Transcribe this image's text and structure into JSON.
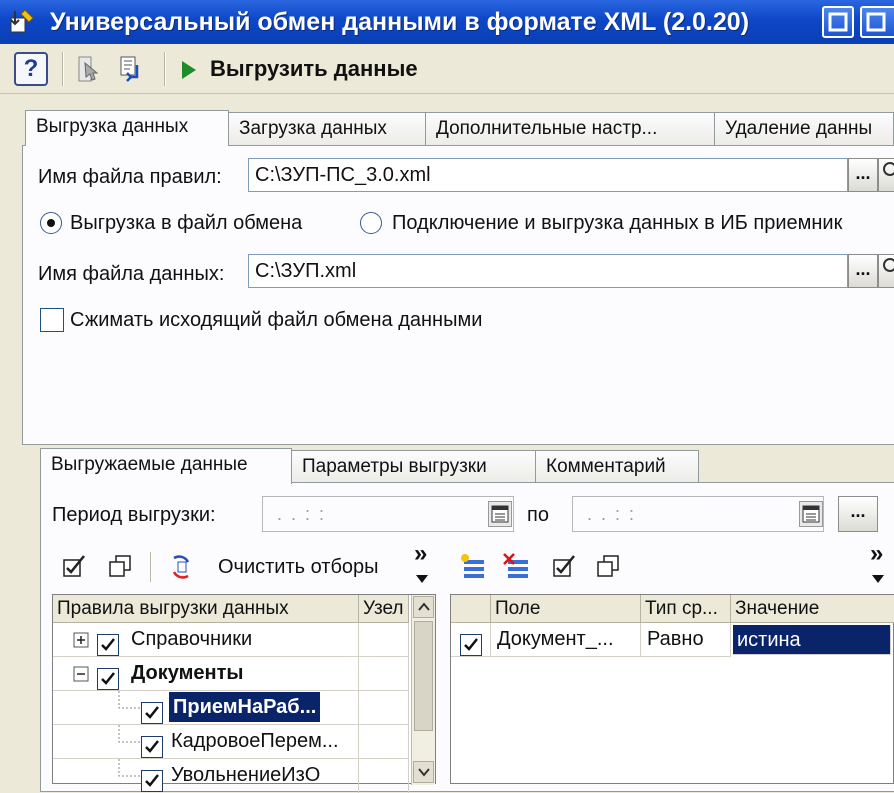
{
  "window": {
    "title": "Универсальный обмен данными в формате XML (2.0.20)"
  },
  "toolbar": {
    "help_label": "?",
    "upload_label": "Выгрузить данные"
  },
  "main_tabs": [
    {
      "label": "Выгрузка данных",
      "active": true
    },
    {
      "label": "Загрузка данных",
      "active": false
    },
    {
      "label": "Дополнительные настр...",
      "active": false
    },
    {
      "label": "Удаление данны",
      "active": false
    }
  ],
  "export": {
    "rules_file_label": "Имя файла правил:",
    "rules_file_value": "C:\\ЗУП-ПС_3.0.xml",
    "browse_label": "...",
    "radio_file_label": "Выгрузка в файл обмена",
    "radio_connect_label": "Подключение и выгрузка данных в ИБ приемник",
    "data_file_label": "Имя файла данных:",
    "data_file_value": "C:\\ЗУП.xml",
    "compress_label": "Сжимать исходящий файл обмена данными"
  },
  "sub_tabs": [
    {
      "label": "Выгружаемые данные",
      "active": true
    },
    {
      "label": "Параметры выгрузки",
      "active": false
    },
    {
      "label": "Комментарий",
      "active": false
    }
  ],
  "period": {
    "label": "Период выгрузки:",
    "from_value": ". .   : :",
    "to_label": "по",
    "to_value": ". .   : :",
    "more_label": "..."
  },
  "left_toolbar": {
    "clear_filters_label": "Очистить отборы",
    "more_label": "»"
  },
  "right_toolbar": {
    "more_label": "»"
  },
  "rules_grid": {
    "columns": [
      "Правила выгрузки данных",
      "Узел"
    ],
    "rows": [
      {
        "label": "Справочники",
        "checked": true,
        "level": 0,
        "expander": "+",
        "bold": false,
        "selected": false
      },
      {
        "label": "Документы",
        "checked": true,
        "level": 0,
        "expander": "−",
        "bold": true,
        "selected": false
      },
      {
        "label": "ПриемНаРаб...",
        "checked": true,
        "level": 1,
        "expander": "",
        "bold": true,
        "selected": true
      },
      {
        "label": "КадровоеПерем...",
        "checked": true,
        "level": 1,
        "expander": "",
        "bold": false,
        "selected": false
      },
      {
        "label": "УвольнениеИзО",
        "checked": true,
        "level": 1,
        "expander": "",
        "bold": false,
        "selected": false
      }
    ]
  },
  "filter_grid": {
    "columns": [
      "Поле",
      "Тип ср...",
      "Значение"
    ],
    "rows": [
      {
        "checked": true,
        "field": "Документ_...",
        "type": "Равно",
        "value": "истина"
      }
    ]
  },
  "icons": {
    "app": "xml-exchange-icon",
    "help": "help-icon",
    "close": "close-icon",
    "maximize": "maximize-icon"
  }
}
